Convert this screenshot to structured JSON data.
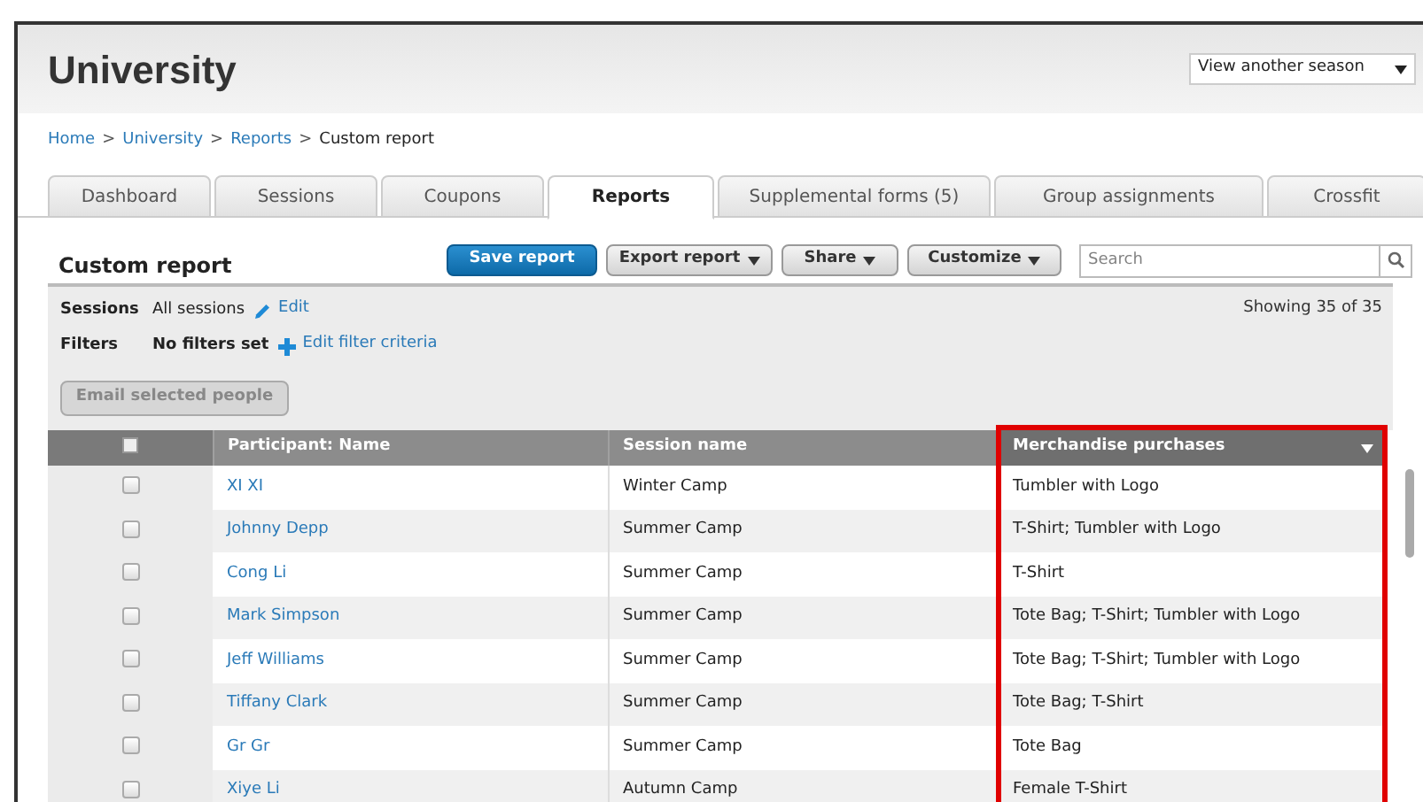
{
  "header": {
    "title": "University",
    "season_select": {
      "value": "View another season"
    }
  },
  "breadcrumbs": [
    {
      "label": "Home",
      "current": false
    },
    {
      "label": "University",
      "current": false
    },
    {
      "label": "Reports",
      "current": false
    },
    {
      "label": "Custom report",
      "current": true
    }
  ],
  "breadcrumb_separator": ">",
  "tabs": [
    {
      "label": "Dashboard",
      "selected": false
    },
    {
      "label": "Sessions",
      "selected": false
    },
    {
      "label": "Coupons",
      "selected": false
    },
    {
      "label": "Reports",
      "selected": true
    },
    {
      "label": "Supplemental forms (5)",
      "selected": false
    },
    {
      "label": "Group assignments",
      "selected": false
    },
    {
      "label": "Crossfit",
      "selected": false
    }
  ],
  "report": {
    "title": "Custom report",
    "buttons": [
      {
        "label": "Save report",
        "kind": "primary",
        "dropdown": false
      },
      {
        "label": "Export report",
        "kind": "secondary",
        "dropdown": true
      },
      {
        "label": "Share",
        "kind": "secondary",
        "dropdown": true
      },
      {
        "label": "Customize",
        "kind": "secondary",
        "dropdown": true
      }
    ],
    "search": {
      "placeholder": "Search"
    },
    "sessions": {
      "label": "Sessions",
      "value": "All sessions",
      "link": "Edit"
    },
    "filters": {
      "label": "Filters",
      "value": "No filters set",
      "link": "Edit filter criteria"
    },
    "showing": "Showing 35 of 35",
    "email_button": {
      "label": "Email selected people",
      "disabled": true
    }
  },
  "table": {
    "select_all": {
      "checked": false
    },
    "columns": [
      {
        "label": "Participant: Name",
        "highlighted": false,
        "menu": false
      },
      {
        "label": "Session name",
        "highlighted": false,
        "menu": false
      },
      {
        "label": "Merchandise purchases",
        "highlighted": true,
        "menu": true
      }
    ],
    "rows": [
      {
        "checked": false,
        "cells": [
          "XI XI",
          "Winter Camp",
          "Tumbler with Logo"
        ]
      },
      {
        "checked": false,
        "cells": [
          "Johnny Depp",
          "Summer Camp",
          "T-Shirt; Tumbler with Logo"
        ]
      },
      {
        "checked": false,
        "cells": [
          "Cong Li",
          "Summer Camp",
          "T-Shirt"
        ]
      },
      {
        "checked": false,
        "cells": [
          "Mark Simpson",
          "Summer Camp",
          "Tote Bag; T-Shirt; Tumbler with Logo"
        ]
      },
      {
        "checked": false,
        "cells": [
          "Jeff Williams",
          "Summer Camp",
          "Tote Bag; T-Shirt; Tumbler with Logo"
        ]
      },
      {
        "checked": false,
        "cells": [
          "Tiffany Clark",
          "Summer Camp",
          "Tote Bag; T-Shirt"
        ]
      },
      {
        "checked": false,
        "cells": [
          "Gr Gr",
          "Summer Camp",
          "Tote Bag"
        ]
      },
      {
        "checked": false,
        "cells": [
          "Xiye Li",
          "Autumn Camp",
          "Female T-Shirt"
        ]
      }
    ]
  }
}
